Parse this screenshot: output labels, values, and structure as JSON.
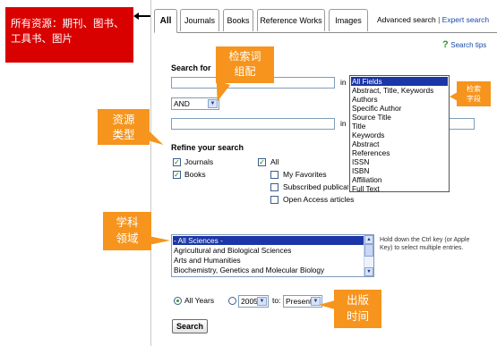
{
  "annotations": {
    "resources_scope": "所有资源：期刊、图书、工具书、图片",
    "search_term_combo": "检索词组配",
    "search_fields": "检索字段",
    "resource_type": "资源类型",
    "subject_area": "学科领域",
    "pub_time": "出版时间"
  },
  "tabs": [
    "All",
    "Journals",
    "Books",
    "Reference Works",
    "Images"
  ],
  "header": {
    "advanced": "Advanced search",
    "sep": "|",
    "expert": "Expert search"
  },
  "search_tips": "Search tips",
  "search_for": "Search for",
  "in_label": "in",
  "operator": "AND",
  "field_options": [
    "All Fields",
    "Abstract, Title, Keywords",
    "Authors",
    "Specific Author",
    "Source Title",
    "Title",
    "Keywords",
    "Abstract",
    "References",
    "ISSN",
    "ISBN",
    "Affiliation",
    "Full Text"
  ],
  "refine": {
    "title": "Refine your search",
    "journals": "Journals",
    "books": "Books",
    "all": "All",
    "my_favorites": "My Favorites",
    "subscribed": "Subscribed publications",
    "open_access": "Open Access articles"
  },
  "subjects": [
    "- All Sciences -",
    "Agricultural and Biological Sciences",
    "Arts and Humanities",
    "Biochemistry, Genetics and Molecular Biology"
  ],
  "ctrl_hint": "Hold down the Ctrl key (or Apple Key) to select multiple entries.",
  "years": {
    "all_years": "All Years",
    "from": "2005",
    "to_label": "to:",
    "to": "Present"
  },
  "search_button": "Search"
}
